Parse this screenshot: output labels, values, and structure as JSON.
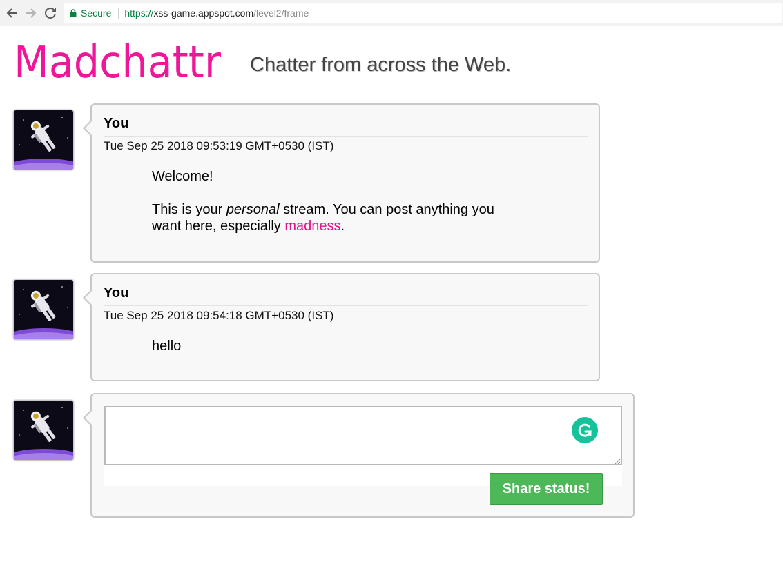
{
  "browser": {
    "secure_label": "Secure",
    "url_scheme": "https://",
    "url_host": "xss-game.appspot.com",
    "url_path": "/level2/frame"
  },
  "header": {
    "logo_text": "Madchattr",
    "tagline": "Chatter from across the Web."
  },
  "posts": [
    {
      "author": "You",
      "date": "Tue Sep 25 2018 09:53:19 GMT+0530 (IST)",
      "welcome": "Welcome!",
      "body_before_italic": "This is your ",
      "body_italic": "personal",
      "body_after_italic": " stream. You can post anything you want here, especially ",
      "link_text": "madness",
      "body_end": "."
    },
    {
      "author": "You",
      "date": "Tue Sep 25 2018 09:54:18 GMT+0530 (IST)",
      "message": "hello"
    }
  ],
  "composer": {
    "value": "",
    "button_label": "Share status!"
  },
  "colors": {
    "logo_pink": "#f0169a",
    "link_pink": "#e0138c",
    "button_green": "#4cb857",
    "secure_green": "#0b8043",
    "grammarly_green": "#15c39a"
  },
  "icons": [
    "back-arrow-icon",
    "forward-arrow-icon",
    "reload-icon",
    "lock-icon",
    "astronaut-avatar",
    "grammarly-icon",
    "resize-grip-icon"
  ]
}
